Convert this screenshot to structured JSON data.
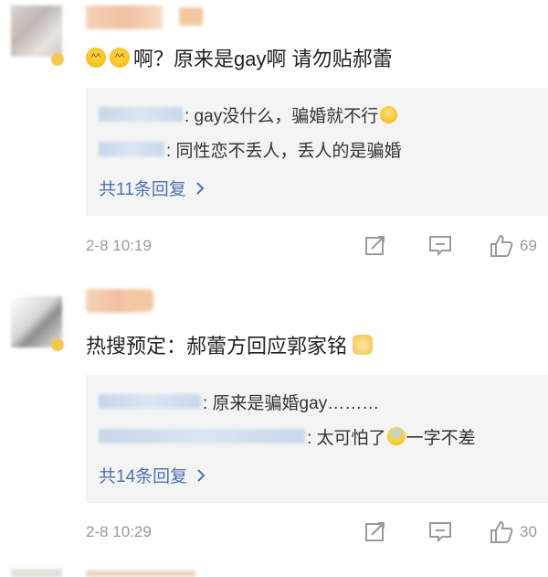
{
  "comments": [
    {
      "text": "啊？原来是gay啊 请勿贴郝蕾",
      "emoji_icons": [
        "grinning-sweat-icon",
        "grinning-sweat-icon"
      ],
      "replies": [
        {
          "text": ": gay没什么，骗婚就不行",
          "trailing_icon": "smile-emoji-icon"
        },
        {
          "text": ": 同性恋不丢人，丢人的是骗婚"
        }
      ],
      "more_replies": "共11条回复",
      "timestamp": "2-8 10:19",
      "like_count": "69"
    },
    {
      "text": "热搜预定：郝蕾方回应郭家铭",
      "trailing_icon": "cat-emoji-icon",
      "replies": [
        {
          "text": ": 原来是骗婚gay………"
        },
        {
          "text_before": ": 太可怕了",
          "emoji_icon": "fearful-face-icon",
          "text_after": "一字不差"
        }
      ],
      "more_replies": "共14条回复",
      "timestamp": "2-8 10:29",
      "like_count": "30"
    }
  ],
  "colors": {
    "link": "#4a73b5",
    "meta": "#999999",
    "reply_bg": "#f4f4f4",
    "text": "#222222"
  }
}
